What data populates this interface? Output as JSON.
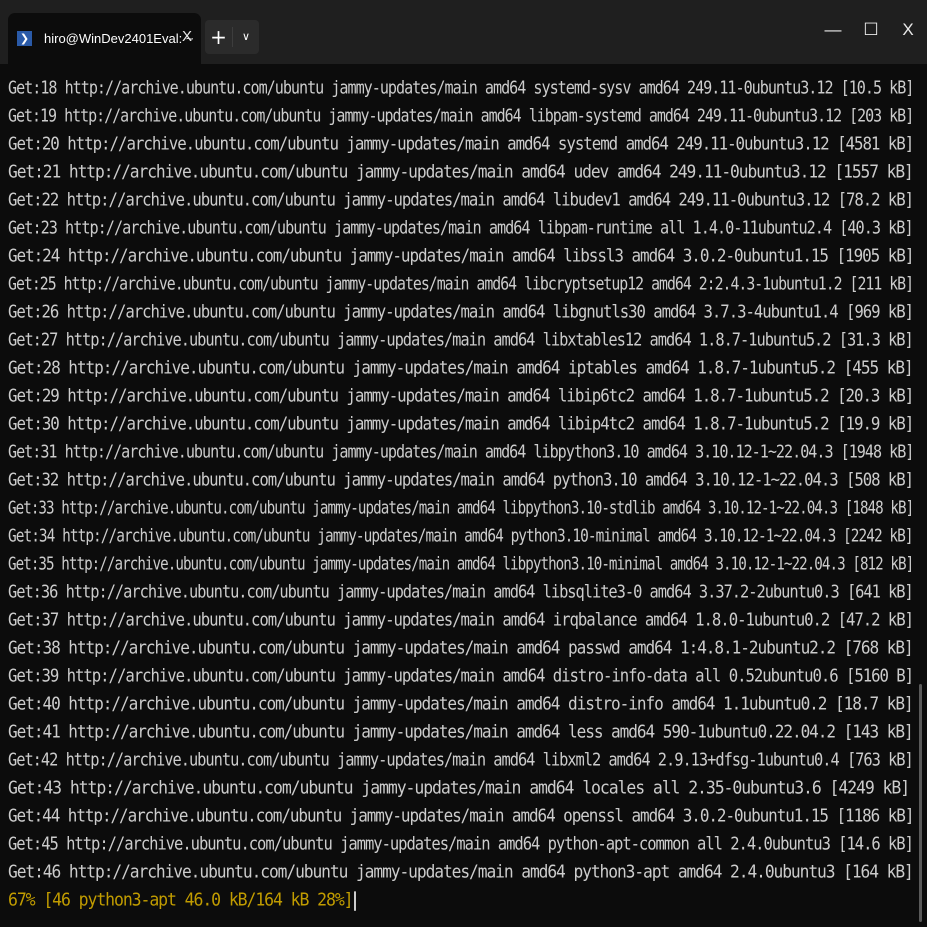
{
  "window": {
    "tab_title": "hiro@WinDev2401Eval: ~",
    "tab_icon_glyph": "❯",
    "tab_close_glyph": "X",
    "new_tab_glyph": "+",
    "dropdown_glyph": "∨",
    "minimize_glyph": "—",
    "maximize_glyph": "☐",
    "close_glyph": "X",
    "colors": {
      "titlebar": "#1f1f1f",
      "terminal_bg": "#0c0c0c",
      "text": "#cccccc",
      "progress_text": "#c19c00"
    }
  },
  "terminal": {
    "lines": [
      "Get:18 http://archive.ubuntu.com/ubuntu jammy-updates/main amd64 systemd-sysv amd64 249.11-0ubuntu3.12 [10.5 kB]",
      "Get:19 http://archive.ubuntu.com/ubuntu jammy-updates/main amd64 libpam-systemd amd64 249.11-0ubuntu3.12 [203 kB]",
      "Get:20 http://archive.ubuntu.com/ubuntu jammy-updates/main amd64 systemd amd64 249.11-0ubuntu3.12 [4581 kB]",
      "Get:21 http://archive.ubuntu.com/ubuntu jammy-updates/main amd64 udev amd64 249.11-0ubuntu3.12 [1557 kB]",
      "Get:22 http://archive.ubuntu.com/ubuntu jammy-updates/main amd64 libudev1 amd64 249.11-0ubuntu3.12 [78.2 kB]",
      "Get:23 http://archive.ubuntu.com/ubuntu jammy-updates/main amd64 libpam-runtime all 1.4.0-11ubuntu2.4 [40.3 kB]",
      "Get:24 http://archive.ubuntu.com/ubuntu jammy-updates/main amd64 libssl3 amd64 3.0.2-0ubuntu1.15 [1905 kB]",
      "Get:25 http://archive.ubuntu.com/ubuntu jammy-updates/main amd64 libcryptsetup12 amd64 2:2.4.3-1ubuntu1.2 [211 kB]",
      "Get:26 http://archive.ubuntu.com/ubuntu jammy-updates/main amd64 libgnutls30 amd64 3.7.3-4ubuntu1.4 [969 kB]",
      "Get:27 http://archive.ubuntu.com/ubuntu jammy-updates/main amd64 libxtables12 amd64 1.8.7-1ubuntu5.2 [31.3 kB]",
      "Get:28 http://archive.ubuntu.com/ubuntu jammy-updates/main amd64 iptables amd64 1.8.7-1ubuntu5.2 [455 kB]",
      "Get:29 http://archive.ubuntu.com/ubuntu jammy-updates/main amd64 libip6tc2 amd64 1.8.7-1ubuntu5.2 [20.3 kB]",
      "Get:30 http://archive.ubuntu.com/ubuntu jammy-updates/main amd64 libip4tc2 amd64 1.8.7-1ubuntu5.2 [19.9 kB]",
      "Get:31 http://archive.ubuntu.com/ubuntu jammy-updates/main amd64 libpython3.10 amd64 3.10.12-1~22.04.3 [1948 kB]",
      "Get:32 http://archive.ubuntu.com/ubuntu jammy-updates/main amd64 python3.10 amd64 3.10.12-1~22.04.3 [508 kB]",
      "Get:33 http://archive.ubuntu.com/ubuntu jammy-updates/main amd64 libpython3.10-stdlib amd64 3.10.12-1~22.04.3 [1848 kB]",
      "Get:34 http://archive.ubuntu.com/ubuntu jammy-updates/main amd64 python3.10-minimal amd64 3.10.12-1~22.04.3 [2242 kB]",
      "Get:35 http://archive.ubuntu.com/ubuntu jammy-updates/main amd64 libpython3.10-minimal amd64 3.10.12-1~22.04.3 [812 kB]",
      "Get:36 http://archive.ubuntu.com/ubuntu jammy-updates/main amd64 libsqlite3-0 amd64 3.37.2-2ubuntu0.3 [641 kB]",
      "Get:37 http://archive.ubuntu.com/ubuntu jammy-updates/main amd64 irqbalance amd64 1.8.0-1ubuntu0.2 [47.2 kB]",
      "Get:38 http://archive.ubuntu.com/ubuntu jammy-updates/main amd64 passwd amd64 1:4.8.1-2ubuntu2.2 [768 kB]",
      "Get:39 http://archive.ubuntu.com/ubuntu jammy-updates/main amd64 distro-info-data all 0.52ubuntu0.6 [5160 B]",
      "Get:40 http://archive.ubuntu.com/ubuntu jammy-updates/main amd64 distro-info amd64 1.1ubuntu0.2 [18.7 kB]",
      "Get:41 http://archive.ubuntu.com/ubuntu jammy-updates/main amd64 less amd64 590-1ubuntu0.22.04.2 [143 kB]",
      "Get:42 http://archive.ubuntu.com/ubuntu jammy-updates/main amd64 libxml2 amd64 2.9.13+dfsg-1ubuntu0.4 [763 kB]",
      "Get:43 http://archive.ubuntu.com/ubuntu jammy-updates/main amd64 locales all 2.35-0ubuntu3.6 [4249 kB]",
      "Get:44 http://archive.ubuntu.com/ubuntu jammy-updates/main amd64 openssl amd64 3.0.2-0ubuntu1.15 [1186 kB]",
      "Get:45 http://archive.ubuntu.com/ubuntu jammy-updates/main amd64 python-apt-common all 2.4.0ubuntu3 [14.6 kB]",
      "Get:46 http://archive.ubuntu.com/ubuntu jammy-updates/main amd64 python3-apt amd64 2.4.0ubuntu3 [164 kB]"
    ],
    "progress_line": "67% [46 python3-apt 46.0 kB/164 kB 28%]"
  }
}
